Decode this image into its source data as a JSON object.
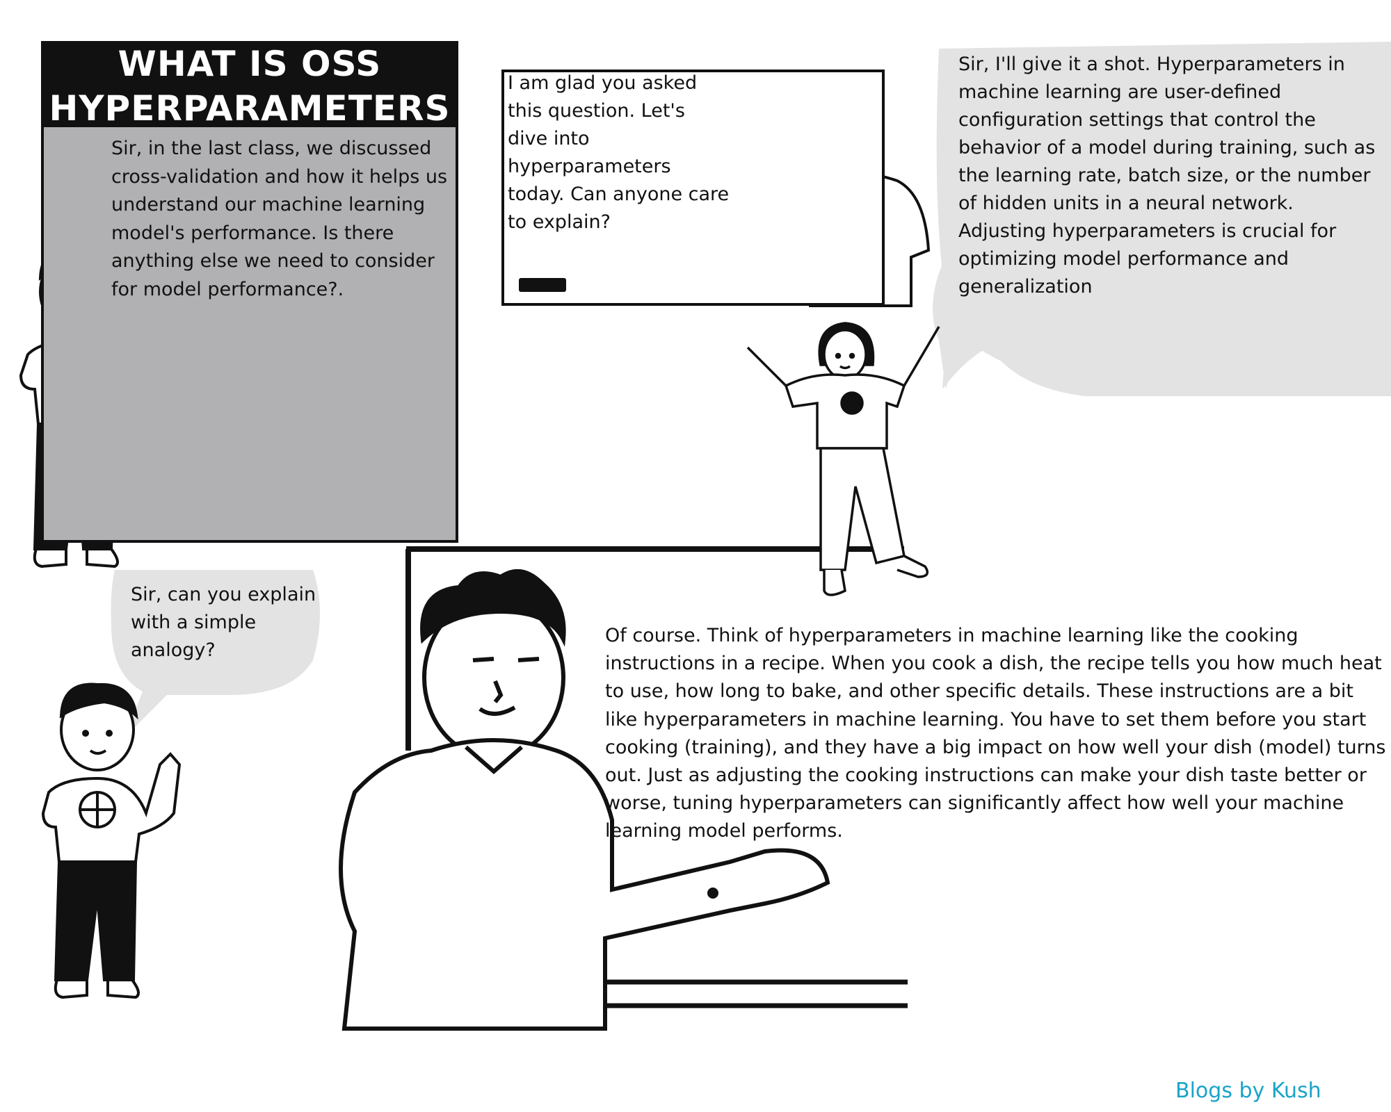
{
  "title": "WHAT IS OSS\nHYPERPARAMETERS",
  "student_question_1": "Sir, in the last class, we discussed cross-validation and how it helps us understand our machine learning model's performance. Is there anything else we need to consider for model performance?.",
  "teacher_reply_1": "I am glad you asked this question. Let's dive into hyperparameters today. Can anyone care to explain?",
  "student_answer": "Sir, I'll give it a shot. Hyperparameters in machine learning are user-defined configuration settings that control the behavior of a model during training, such as the learning rate, batch size, or the number of hidden units in a neural network. Adjusting hyperparameters is crucial for optimizing model performance and generalization",
  "student_question_2": "Sir, can you explain with a simple analogy?",
  "teacher_reply_2": "Of course. Think of hyperparameters in machine learning like the cooking instructions in a recipe. When you cook a dish, the recipe tells you how much heat to use, how long to bake, and other specific details. These instructions are a bit like hyperparameters in machine learning. You have to set them before you start cooking (training), and they have a big impact on how well your dish (model) turns out. Just as adjusting the cooking instructions can make your dish taste better or worse, tuning hyperparameters can significantly affect how well your machine learning model performs.",
  "footer": "Blogs by Kush",
  "colors": {
    "panel_grey": "#b1b1b3",
    "bubble_grey": "#e3e3e3",
    "title_bg": "#111111",
    "footer_blue": "#1aa3c9"
  }
}
